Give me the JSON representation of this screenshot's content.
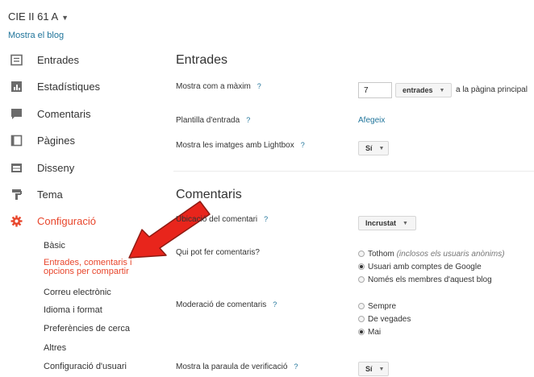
{
  "header": {
    "blog_title": "CIE II 61 A",
    "view_blog": "Mostra el blog"
  },
  "sidebar": {
    "items": [
      {
        "label": "Entrades",
        "icon": "posts-icon"
      },
      {
        "label": "Estadístiques",
        "icon": "stats-icon"
      },
      {
        "label": "Comentaris",
        "icon": "comments-icon"
      },
      {
        "label": "Pàgines",
        "icon": "pages-icon"
      },
      {
        "label": "Disseny",
        "icon": "layout-icon"
      },
      {
        "label": "Tema",
        "icon": "theme-icon"
      },
      {
        "label": "Configuració",
        "icon": "gear-icon",
        "active": true
      }
    ],
    "subitems": [
      {
        "label": "Bàsic"
      },
      {
        "label_line1": "Entrades, comentaris i",
        "label_line2": "opcions per compartir",
        "active": true
      },
      {
        "label": "Correu electrònic"
      },
      {
        "label": "Idioma i format"
      },
      {
        "label": "Preferències de cerca"
      },
      {
        "label": "Altres"
      },
      {
        "label": "Configuració d'usuari"
      }
    ]
  },
  "posts_section": {
    "title": "Entrades",
    "max_posts_label": "Mostra com a màxim",
    "max_posts_value": "7",
    "max_posts_unit": "entrades",
    "max_posts_suffix": "a la pàgina principal",
    "template_label": "Plantilla d'entrada",
    "template_link": "Afegeix",
    "lightbox_label": "Mostra les imatges amb Lightbox",
    "lightbox_value": "Sí"
  },
  "comments_section": {
    "title": "Comentaris",
    "location_label": "Ubicació del comentari",
    "location_value": "Incrustat",
    "who_label": "Qui pot fer comentaris?",
    "who_options": [
      {
        "label": "Tothom",
        "note": "(inclosos els usuaris anònims)",
        "checked": false
      },
      {
        "label": "Usuari amb comptes de Google",
        "checked": true
      },
      {
        "label": "Només els membres d'aquest blog",
        "checked": false
      }
    ],
    "moderation_label": "Moderació de comentaris",
    "moderation_options": [
      {
        "label": "Sempre",
        "checked": false
      },
      {
        "label": "De vegades",
        "checked": false
      },
      {
        "label": "Mai",
        "checked": true
      }
    ],
    "verification_label": "Mostra la paraula de verificació",
    "verification_value": "Sí"
  },
  "help_symbol": "?",
  "colors": {
    "accent": "#e8462c",
    "link": "#21759b",
    "arrow": "#e8251c"
  }
}
